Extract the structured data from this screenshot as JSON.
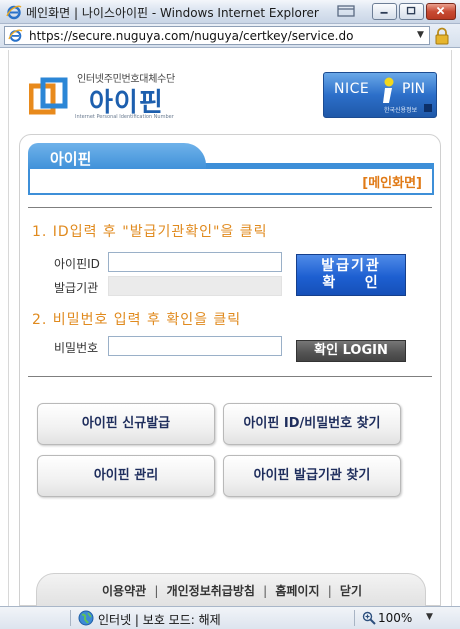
{
  "window": {
    "title": "메인화면 | 나이스아이핀 - Windows Internet Explorer",
    "url": "https://secure.nuguya.com/nuguya/certkey/service.do"
  },
  "header": {
    "tagline": "인터넷주민번호대체수단",
    "brand": "아이핀",
    "brand_sub": "Internet Personal Identification Number",
    "partner_logo_text": "NICE",
    "partner_logo_pin": "PIN",
    "partner_logo_sub": "한국신용정보"
  },
  "panel": {
    "tab_label": "아이핀",
    "main_link": "[메인화면]"
  },
  "step1": {
    "title": "1. ID입력 후 \"발급기관확인\"을 클릭",
    "id_label": "아이핀ID",
    "id_value": "",
    "issuer_label": "발급기관",
    "issuer_value": "",
    "confirm_button_line1": "발급기관",
    "confirm_button_line2": "확    인"
  },
  "step2": {
    "title": "2. 비밀번호 입력 후 확인을 클릭",
    "password_label": "비밀번호",
    "password_value": "",
    "login_button": "확인 LOGIN"
  },
  "menu": {
    "new_issue": "아이핀 신규발급",
    "find_id_pw": "아이핀 ID/비밀번호 찾기",
    "manage": "아이핀 관리",
    "find_issuer": "아이핀 발급기관 찾기"
  },
  "footer": {
    "terms": "이용약관",
    "privacy": "개인정보취급방침",
    "homepage": "홈페이지",
    "close": "닫기",
    "separator": "|"
  },
  "status": {
    "zone": "인터넷 | 보호 모드: 해제",
    "zoom": "100%"
  },
  "colors": {
    "accent_orange": "#e08a1e",
    "tab_blue": "#3d8fd8",
    "button_blue": "#1d5fd1",
    "brand_blue": "#1d5fae"
  }
}
